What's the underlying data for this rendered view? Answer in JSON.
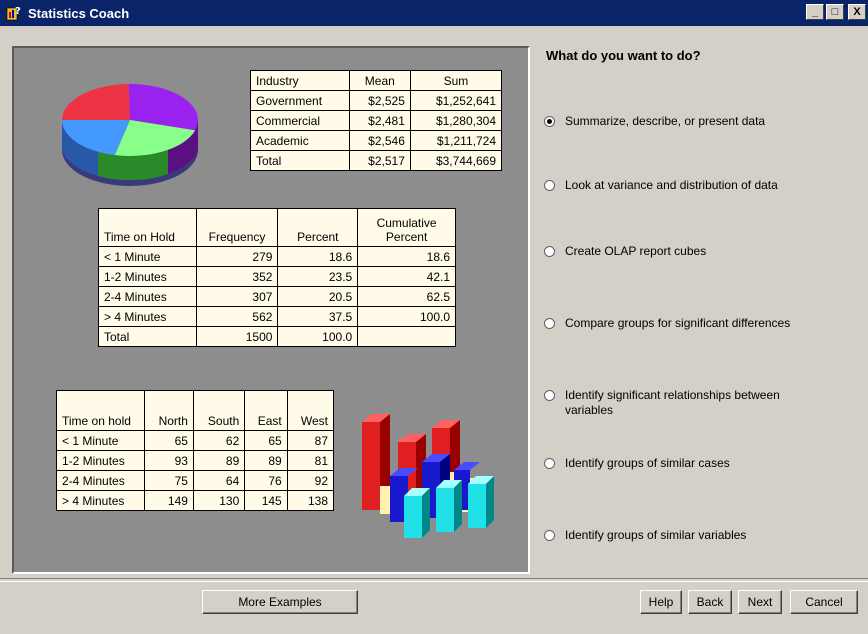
{
  "window": {
    "title": "Statistics Coach",
    "icon": "statistics-coach-app-icon"
  },
  "controls": {
    "minimize": "_",
    "maximize": "□",
    "close": "X"
  },
  "examples": {
    "industry_table": {
      "headers": [
        "Industry",
        "Mean",
        "Sum"
      ],
      "rows": [
        [
          "Government",
          "$2,525",
          "$1,252,641"
        ],
        [
          "Commercial",
          "$2,481",
          "$1,280,304"
        ],
        [
          "Academic",
          "$2,546",
          "$1,211,724"
        ],
        [
          "Total",
          "$2,517",
          "$3,744,669"
        ]
      ]
    },
    "frequency_table": {
      "headers": [
        "Time on Hold",
        "Frequency",
        "Percent",
        "Cumulative Percent"
      ],
      "rows": [
        [
          "< 1 Minute",
          "279",
          "18.6",
          "18.6"
        ],
        [
          "1-2 Minutes",
          "352",
          "23.5",
          "42.1"
        ],
        [
          "2-4 Minutes",
          "307",
          "20.5",
          "62.5"
        ],
        [
          "> 4 Minutes",
          "562",
          "37.5",
          "100.0"
        ],
        [
          "Total",
          "1500",
          "100.0",
          ""
        ]
      ]
    },
    "region_table": {
      "headers": [
        "Time on hold",
        "North",
        "South",
        "East",
        "West"
      ],
      "rows": [
        [
          "< 1 Minute",
          "65",
          "62",
          "65",
          "87"
        ],
        [
          "1-2 Minutes",
          "93",
          "89",
          "89",
          "81"
        ],
        [
          "2-4 Minutes",
          "75",
          "64",
          "76",
          "92"
        ],
        [
          "> 4 Minutes",
          "149",
          "130",
          "145",
          "138"
        ]
      ]
    },
    "pie_colors": [
      "#ee3344",
      "#9922ee",
      "#88ff88",
      "#4499ff"
    ],
    "bar_colors": {
      "red": "#e02020",
      "yellow": "#fff3b0",
      "blue": "#1818cc",
      "cyan": "#20e0e8"
    }
  },
  "question": "What do you want to do?",
  "options": [
    {
      "label": "Summarize, describe, or present data",
      "selected": true
    },
    {
      "label": "Look at variance and distribution of data",
      "selected": false
    },
    {
      "label": "Create OLAP report cubes",
      "selected": false
    },
    {
      "label": "Compare groups for significant differences",
      "selected": false
    },
    {
      "label": "Identify significant relationships between variables",
      "selected": false
    },
    {
      "label": "Identify groups of similar cases",
      "selected": false
    },
    {
      "label": "Identify groups of similar variables",
      "selected": false
    }
  ],
  "buttons": {
    "more_examples": "More Examples",
    "help": "Help",
    "back": "Back",
    "next": "Next",
    "cancel": "Cancel"
  }
}
